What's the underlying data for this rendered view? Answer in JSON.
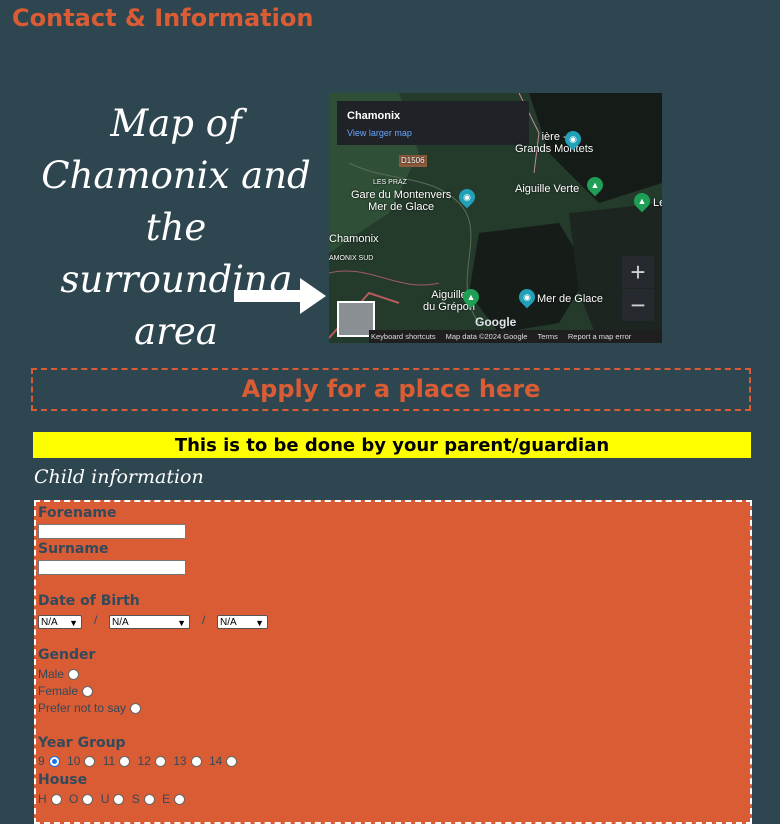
{
  "page": {
    "title": "Contact & Information"
  },
  "map_section": {
    "caption": "Map of Chamonix and the surrounding area",
    "map": {
      "place_name": "Chamonix",
      "view_larger": "View larger map",
      "labels": {
        "road": "D1506",
        "les_praz": "LES PRAZ",
        "montenvers": "Gare du Montenvers\nMer de Glace",
        "chamonix": "Chamonix",
        "chamonix_sud": "AMONIX SUD",
        "aiguille_verte": "Aiguille Verte",
        "grands_montets": "ière -\nGrands Montets",
        "le": "Le",
        "aiguille_grepon": "Aiguille\ndu Grépon",
        "mer_de_glace": "Mer de Glace"
      },
      "zoom_in": "+",
      "zoom_out": "−",
      "google": "Google",
      "footer": [
        "Keyboard shortcuts",
        "Map data ©2024 Google",
        "Terms",
        "Report a map error"
      ]
    }
  },
  "apply": {
    "label": "Apply for a place here"
  },
  "banner": {
    "text": "This is to be done by your parent/guardian"
  },
  "child_section": {
    "heading": "Child information"
  },
  "form": {
    "forename_label": "Forename",
    "forename_value": "",
    "surname_label": "Surname",
    "surname_value": "",
    "dob_label": "Date of Birth",
    "dob_day": "N/A",
    "dob_month": "N/A",
    "dob_year": "N/A",
    "separator": "/",
    "gender_label": "Gender",
    "gender_options": [
      "Male",
      "Female",
      "Prefer not to say"
    ],
    "year_group_label": "Year Group",
    "year_groups": [
      "9",
      "10",
      "11",
      "12",
      "13",
      "14"
    ],
    "year_group_selected": "9",
    "house_label": "House",
    "houses": [
      "H",
      "O",
      "U",
      "S",
      "E"
    ]
  },
  "colors": {
    "accent": "#d95c34",
    "background": "#2e4650",
    "banner": "#ffff00",
    "form_text": "#34495a"
  }
}
